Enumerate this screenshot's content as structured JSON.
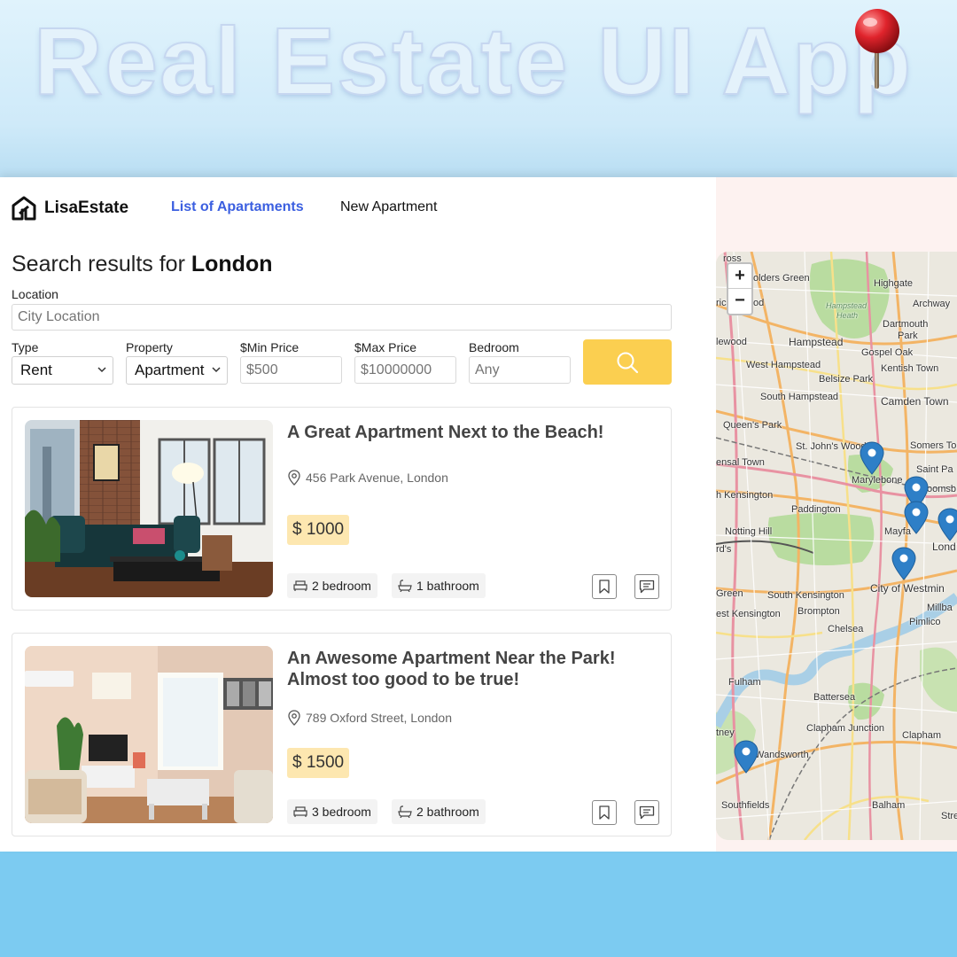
{
  "hero": {
    "title": "Real Estate UI App"
  },
  "brand": {
    "name": "LisaEstate"
  },
  "nav": {
    "list": "List of Apartaments",
    "new": "New Apartment"
  },
  "search": {
    "title_prefix": "Search results for ",
    "title_city": "London",
    "location_label": "Location",
    "location_placeholder": "City Location",
    "type_label": "Type",
    "type_value": "Rent",
    "property_label": "Property",
    "property_value": "Apartment",
    "min_label": "$Min Price",
    "min_placeholder": "$500",
    "max_label": "$Max Price",
    "max_placeholder": "$10000000",
    "bedroom_label": "Bedroom",
    "bedroom_placeholder": "Any"
  },
  "listings": [
    {
      "title": "A Great Apartment Next to the Beach!",
      "address": "456 Park Avenue, London",
      "price": "$ 1000",
      "bedrooms": "2 bedroom",
      "bathrooms": "1 bathroom"
    },
    {
      "title": "An Awesome Apartment Near the Park! Almost too good to be true!",
      "address": "789 Oxford Street, London",
      "price": "$ 1500",
      "bedrooms": "3 bedroom",
      "bathrooms": "2 bathroom"
    }
  ],
  "map": {
    "zoom_in": "+",
    "zoom_out": "−",
    "labels": {
      "cross": "ross",
      "golders": "olders Green",
      "highgate": "Highgate",
      "ricl": "ricl",
      "od": "od",
      "hampstead_heath_1": "Hampstead",
      "hampstead_heath_2": "Heath",
      "archway": "Archway",
      "dartmouth": "Dartmouth",
      "park": "Park",
      "kilewood": "lewood",
      "hampstead": "Hampstead",
      "gospel_oak": "Gospel Oak",
      "west_hampstead": "West Hampstead",
      "kentish_town": "Kentish Town",
      "belsize_park": "Belsize Park",
      "south_hampstead": "South Hampstead",
      "camden_town": "Camden Town",
      "queens_park": "Queen's Park",
      "st_johns_wood": "St. John's Wood",
      "somers_town": "Somers To",
      "kensal_town": "ensal Town",
      "saint_pa": "Saint Pa",
      "marylebone": "Marylebone",
      "bloomsbury": "oomsb",
      "kensington_n": "h Kensington",
      "paddington": "Paddington",
      "notting_hill": "Notting Hill",
      "mayfair": "Mayfa",
      "rds": "rd's",
      "london": "Lond",
      "green": "Green",
      "south_kensington": "South Kensington",
      "city_of_westminster": "City of Westmin",
      "est_kensington": "est Kensington",
      "brompton": "Brompton",
      "millbank": "Millba",
      "pimlico": "Pimlico",
      "chelsea": "Chelsea",
      "fulham": "Fulham",
      "battersea": "Battersea",
      "tney": "tney",
      "clapham_junction": "Clapham Junction",
      "clapham": "Clapham",
      "wandsworth": "Wandsworth",
      "southfields": "Southfields",
      "balham": "Balham",
      "stre": "Stre"
    }
  }
}
